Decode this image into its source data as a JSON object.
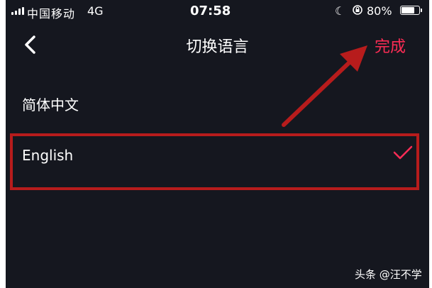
{
  "status_bar": {
    "carrier": "中国移动",
    "network": "4G",
    "time": "07:58",
    "moon_glyph": "☾",
    "battery": "80%",
    "battery_level": 0.8
  },
  "nav": {
    "title": "切换语言",
    "done_label": "完成"
  },
  "languages": [
    {
      "label": "简体中文",
      "selected": false
    },
    {
      "label": "English",
      "selected": true
    }
  ],
  "watermark": "头条 @汪不学",
  "colors": {
    "background": "#15171f",
    "accent": "#fe2c55",
    "annotation": "#b71c1c"
  }
}
